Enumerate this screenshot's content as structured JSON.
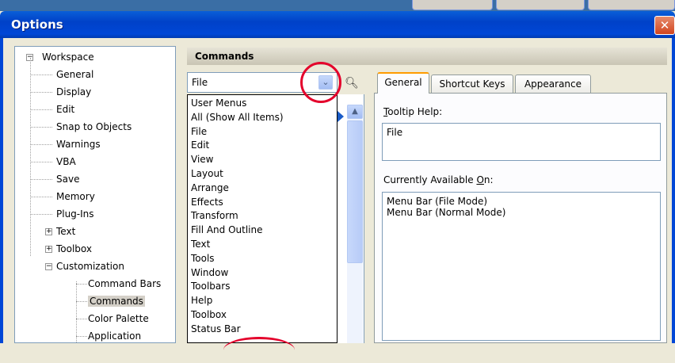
{
  "window": {
    "title": "Options",
    "close_glyph": "✕"
  },
  "tree": [
    {
      "label": "Workspace",
      "level": 0,
      "expander": "-"
    },
    {
      "label": "General",
      "level": 1
    },
    {
      "label": "Display",
      "level": 1
    },
    {
      "label": "Edit",
      "level": 1
    },
    {
      "label": "Snap to Objects",
      "level": 1
    },
    {
      "label": "Warnings",
      "level": 1
    },
    {
      "label": "VBA",
      "level": 1
    },
    {
      "label": "Save",
      "level": 1
    },
    {
      "label": "Memory",
      "level": 1
    },
    {
      "label": "Plug-Ins",
      "level": 1
    },
    {
      "label": "Text",
      "level": 1,
      "expander": "+"
    },
    {
      "label": "Toolbox",
      "level": 1,
      "expander": "+"
    },
    {
      "label": "Customization",
      "level": 1,
      "expander": "-"
    },
    {
      "label": "Command Bars",
      "level": 2
    },
    {
      "label": "Commands",
      "level": 2,
      "selected": true
    },
    {
      "label": "Color Palette",
      "level": 2
    },
    {
      "label": "Application",
      "level": 2
    }
  ],
  "commands": {
    "header": "Commands",
    "combo_value": "File",
    "dropdown_items": [
      "User Menus",
      "All (Show All Items)",
      "File",
      "Edit",
      "View",
      "Layout",
      "Arrange",
      "Effects",
      "Transform",
      "Fill And Outline",
      "Text",
      "Tools",
      "Window",
      "Toolbars",
      "Help",
      "Toolbox",
      "Status Bar"
    ]
  },
  "tabs": [
    "General",
    "Shortcut Keys",
    "Appearance"
  ],
  "general": {
    "tooltip_label_underline": "T",
    "tooltip_label_rest": "ooltip Help:",
    "tooltip_value": "File",
    "available_label_start": "Currently Available ",
    "available_label_underline": "O",
    "available_label_rest": "n:",
    "available_items": [
      "Menu Bar (File Mode)",
      "Menu Bar (Normal Mode)"
    ]
  },
  "colors": {
    "title_bar": "#0047d6",
    "highlight_annotation": "#e4002b"
  },
  "icons": {
    "combo_arrow": "chevron-down-icon",
    "find": "binoculars-icon",
    "scroll_up": "scroll-up-icon",
    "close": "close-icon"
  }
}
